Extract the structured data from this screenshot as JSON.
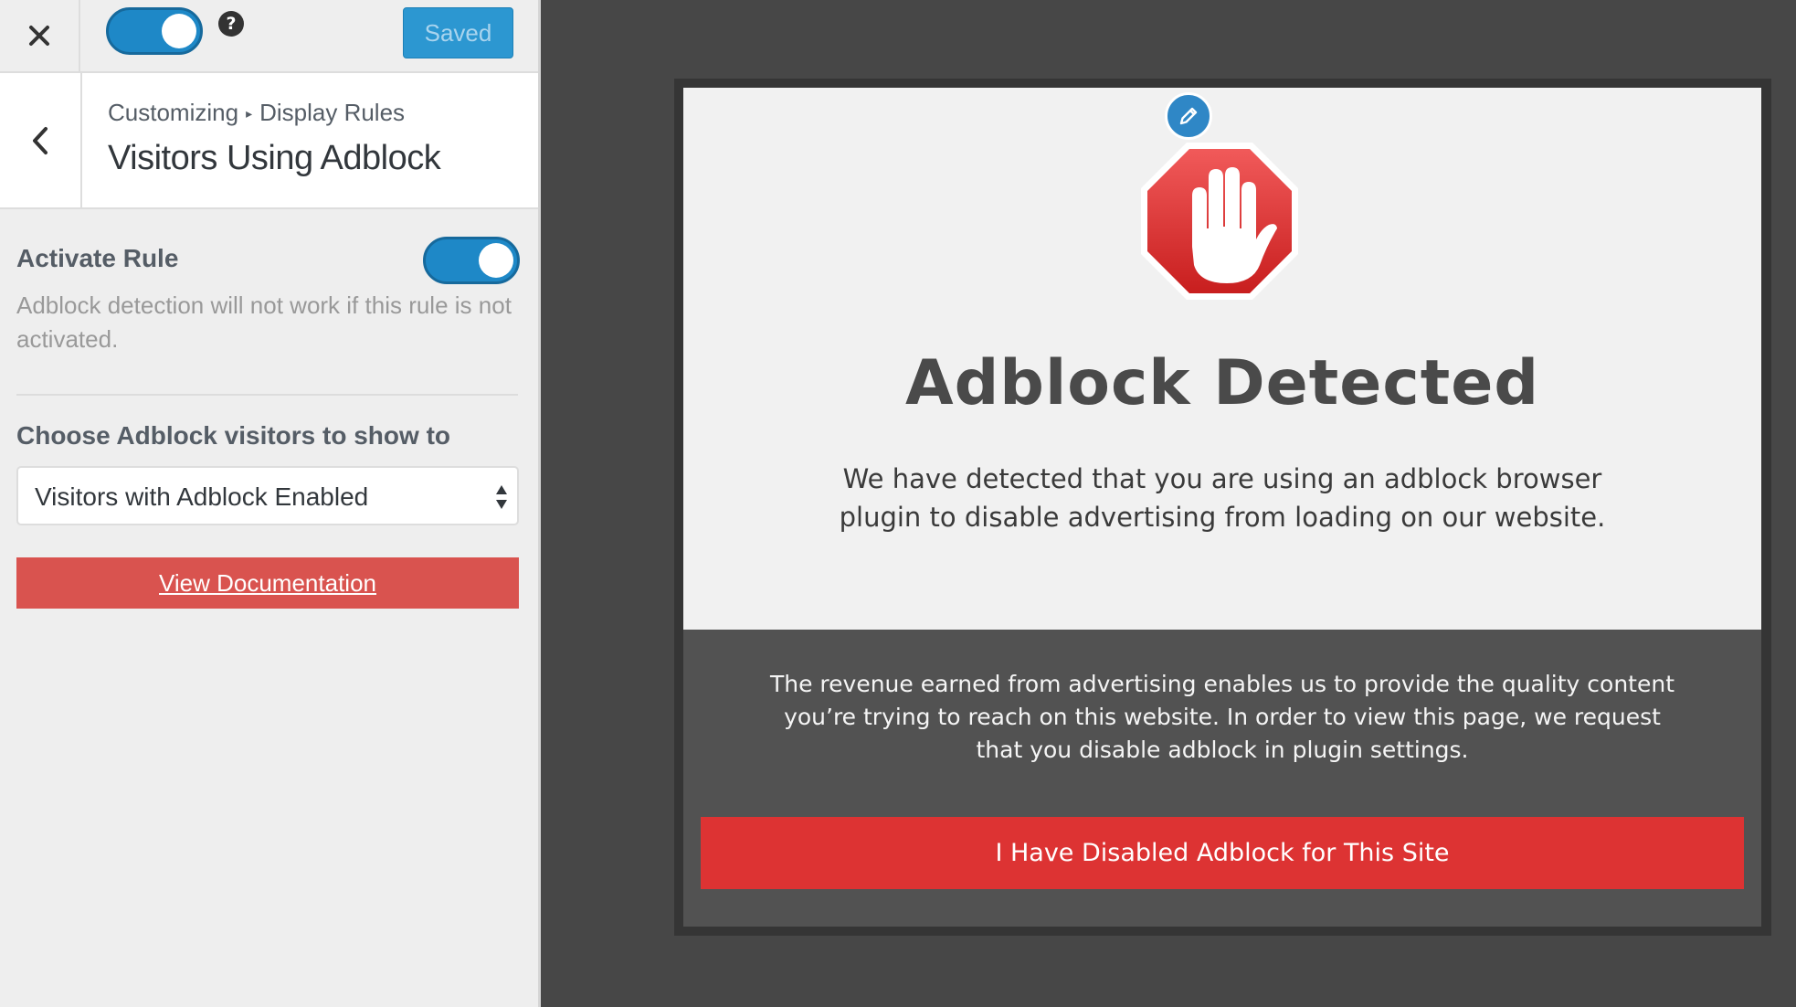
{
  "topbar": {
    "close_icon": "close-icon",
    "help_icon": "help-icon",
    "help_glyph": "?",
    "saved_label": "Saved",
    "accent_color": "#1e88c7"
  },
  "section_header": {
    "back_icon": "chevron-left-icon",
    "breadcrumb_root": "Customizing",
    "breadcrumb_separator": "▸",
    "breadcrumb_current": "Display Rules",
    "title": "Visitors Using Adblock"
  },
  "activate_rule": {
    "label": "Activate Rule",
    "enabled": true,
    "description": "Adblock detection will not work if this rule is not activated."
  },
  "visitors_select": {
    "label": "Choose Adblock visitors to show to",
    "selected": "Visitors with Adblock Enabled"
  },
  "documentation": {
    "label": "View Documentation",
    "color": "#d9534f"
  },
  "preview": {
    "edit_icon": "pencil-icon",
    "stop_icon": "adblock-stop-hand-icon",
    "title": "Adblock Detected",
    "description_lines": [
      "We have detected that you are using an adblock browser",
      "plugin to disable advertising from loading on our website."
    ],
    "footer_lines": [
      "The revenue earned from advertising enables us to provide the quality content",
      "you’re trying to reach on this website. In order to view this page, we request",
      "that you disable adblock in plugin settings."
    ],
    "button_label": "I Have Disabled Adblock for This Site",
    "button_color": "#dd3333"
  }
}
